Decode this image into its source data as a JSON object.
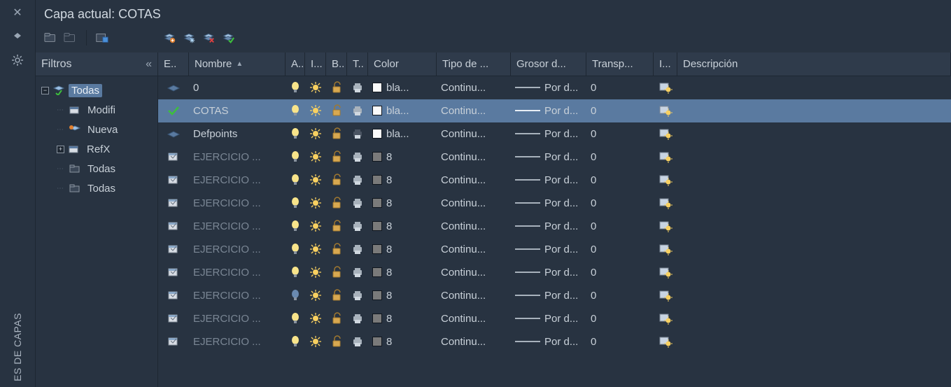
{
  "leftStrip": {
    "verticalLabel": "ES DE CAPAS"
  },
  "header": {
    "currentLayerLabel": "Capa actual: COTAS"
  },
  "filters": {
    "title": "Filtros",
    "nodes": {
      "root": "Todas",
      "modif": "Modifi",
      "nueva": "Nueva",
      "refx": "RefX",
      "todas1": "Todas",
      "todas2": "Todas"
    }
  },
  "columns": {
    "status": "E..",
    "name": "Nombre",
    "on": "A..",
    "freeze": "I...",
    "lock": "B..",
    "plot": "T..",
    "color": "Color",
    "linetype": "Tipo de ...",
    "lineweight": "Grosor d...",
    "transparency": "Transp...",
    "newvp": "I...",
    "description": "Descripción"
  },
  "rows": [
    {
      "status": "current-off",
      "name": "0",
      "dim": false,
      "on": true,
      "sel": false,
      "plot": "on",
      "colorClass": "sw-white",
      "colorLabel": "bla...",
      "linetype": "Continu...",
      "lineweight": "Por d...",
      "transp": "0"
    },
    {
      "status": "check",
      "name": "COTAS",
      "dim": false,
      "on": true,
      "sel": true,
      "plot": "on",
      "colorClass": "sw-white",
      "colorLabel": "bla...",
      "linetype": "Continu...",
      "lineweight": "Por d...",
      "transp": "0"
    },
    {
      "status": "current-off",
      "name": "Defpoints",
      "dim": false,
      "on": true,
      "sel": false,
      "plot": "off",
      "colorClass": "sw-white",
      "colorLabel": "bla...",
      "linetype": "Continu...",
      "lineweight": "Por d...",
      "transp": "0"
    },
    {
      "status": "xref",
      "name": "EJERCICIO ...",
      "dim": true,
      "on": true,
      "sel": false,
      "plot": "on",
      "colorClass": "sw-grey",
      "colorLabel": "8",
      "linetype": "Continu...",
      "lineweight": "Por d...",
      "transp": "0"
    },
    {
      "status": "xref",
      "name": "EJERCICIO ...",
      "dim": true,
      "on": true,
      "sel": false,
      "plot": "on",
      "colorClass": "sw-grey",
      "colorLabel": "8",
      "linetype": "Continu...",
      "lineweight": "Por d...",
      "transp": "0"
    },
    {
      "status": "xref",
      "name": "EJERCICIO ...",
      "dim": true,
      "on": true,
      "sel": false,
      "plot": "on",
      "colorClass": "sw-grey",
      "colorLabel": "8",
      "linetype": "Continu...",
      "lineweight": "Por d...",
      "transp": "0"
    },
    {
      "status": "xref",
      "name": "EJERCICIO ...",
      "dim": true,
      "on": true,
      "sel": false,
      "plot": "on",
      "colorClass": "sw-grey",
      "colorLabel": "8",
      "linetype": "Continu...",
      "lineweight": "Por d...",
      "transp": "0"
    },
    {
      "status": "xref",
      "name": "EJERCICIO ...",
      "dim": true,
      "on": true,
      "sel": false,
      "plot": "on",
      "colorClass": "sw-grey",
      "colorLabel": "8",
      "linetype": "Continu...",
      "lineweight": "Por d...",
      "transp": "0"
    },
    {
      "status": "xref",
      "name": "EJERCICIO ...",
      "dim": true,
      "on": true,
      "sel": false,
      "plot": "on",
      "colorClass": "sw-grey",
      "colorLabel": "8",
      "linetype": "Continu...",
      "lineweight": "Por d...",
      "transp": "0"
    },
    {
      "status": "xref",
      "name": "EJERCICIO ...",
      "dim": true,
      "on": false,
      "sel": false,
      "plot": "on",
      "colorClass": "sw-grey",
      "colorLabel": "8",
      "linetype": "Continu...",
      "lineweight": "Por d...",
      "transp": "0"
    },
    {
      "status": "xref",
      "name": "EJERCICIO ...",
      "dim": true,
      "on": true,
      "sel": false,
      "plot": "on",
      "colorClass": "sw-grey",
      "colorLabel": "8",
      "linetype": "Continu...",
      "lineweight": "Por d...",
      "transp": "0"
    },
    {
      "status": "xref",
      "name": "EJERCICIO ...",
      "dim": true,
      "on": true,
      "sel": false,
      "plot": "on",
      "colorClass": "sw-grey",
      "colorLabel": "8",
      "linetype": "Continu...",
      "lineweight": "Por d...",
      "transp": "0"
    }
  ]
}
